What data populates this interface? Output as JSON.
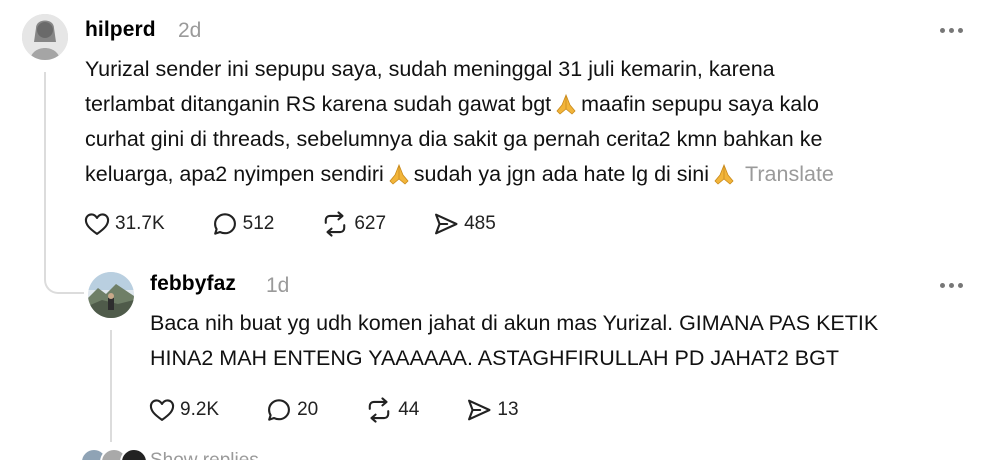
{
  "post": {
    "username": "hilperd",
    "time": "2d",
    "lines": [
      "Yurizal sender ini sepupu saya, sudah meninggal 31 juli kemarin, karena",
      "terlambat ditanganin RS karena sudah gawat bgt",
      "maafin sepupu saya kalo",
      "curhat gini di threads, sebelumnya dia sakit ga pernah cerita2 kmn bahkan ke",
      "keluarga, apa2 nyimpen sendiri",
      "sudah ya jgn ada hate lg di sini"
    ],
    "translate_label": "Translate",
    "likes": "31.7K",
    "replies": "512",
    "reposts": "627",
    "shares": "485",
    "more_icon": "more-horizontal-icon"
  },
  "reply": {
    "username": "febbyfaz",
    "time": "1d",
    "lines": [
      "Baca nih buat yg udh komen jahat di akun mas Yurizal. GIMANA PAS KETIK",
      "HINA2 MAH ENTENG YAAAAAA. ASTAGHFIRULLAH PD JAHAT2 BGT"
    ],
    "likes": "9.2K",
    "replies": "20",
    "reposts": "44",
    "shares": "13",
    "more_icon": "more-horizontal-icon"
  },
  "footer": {
    "partial_text": "Show replies"
  },
  "icons": {
    "like": "heart-icon",
    "reply": "comment-bubble-icon",
    "repost": "repost-arrows-icon",
    "share": "send-icon",
    "emoji": "folded-hands-emoji"
  },
  "colors": {
    "muted": "#9a9a9a",
    "thread_line": "#dcdcdc",
    "emoji": "#f2b53a"
  }
}
